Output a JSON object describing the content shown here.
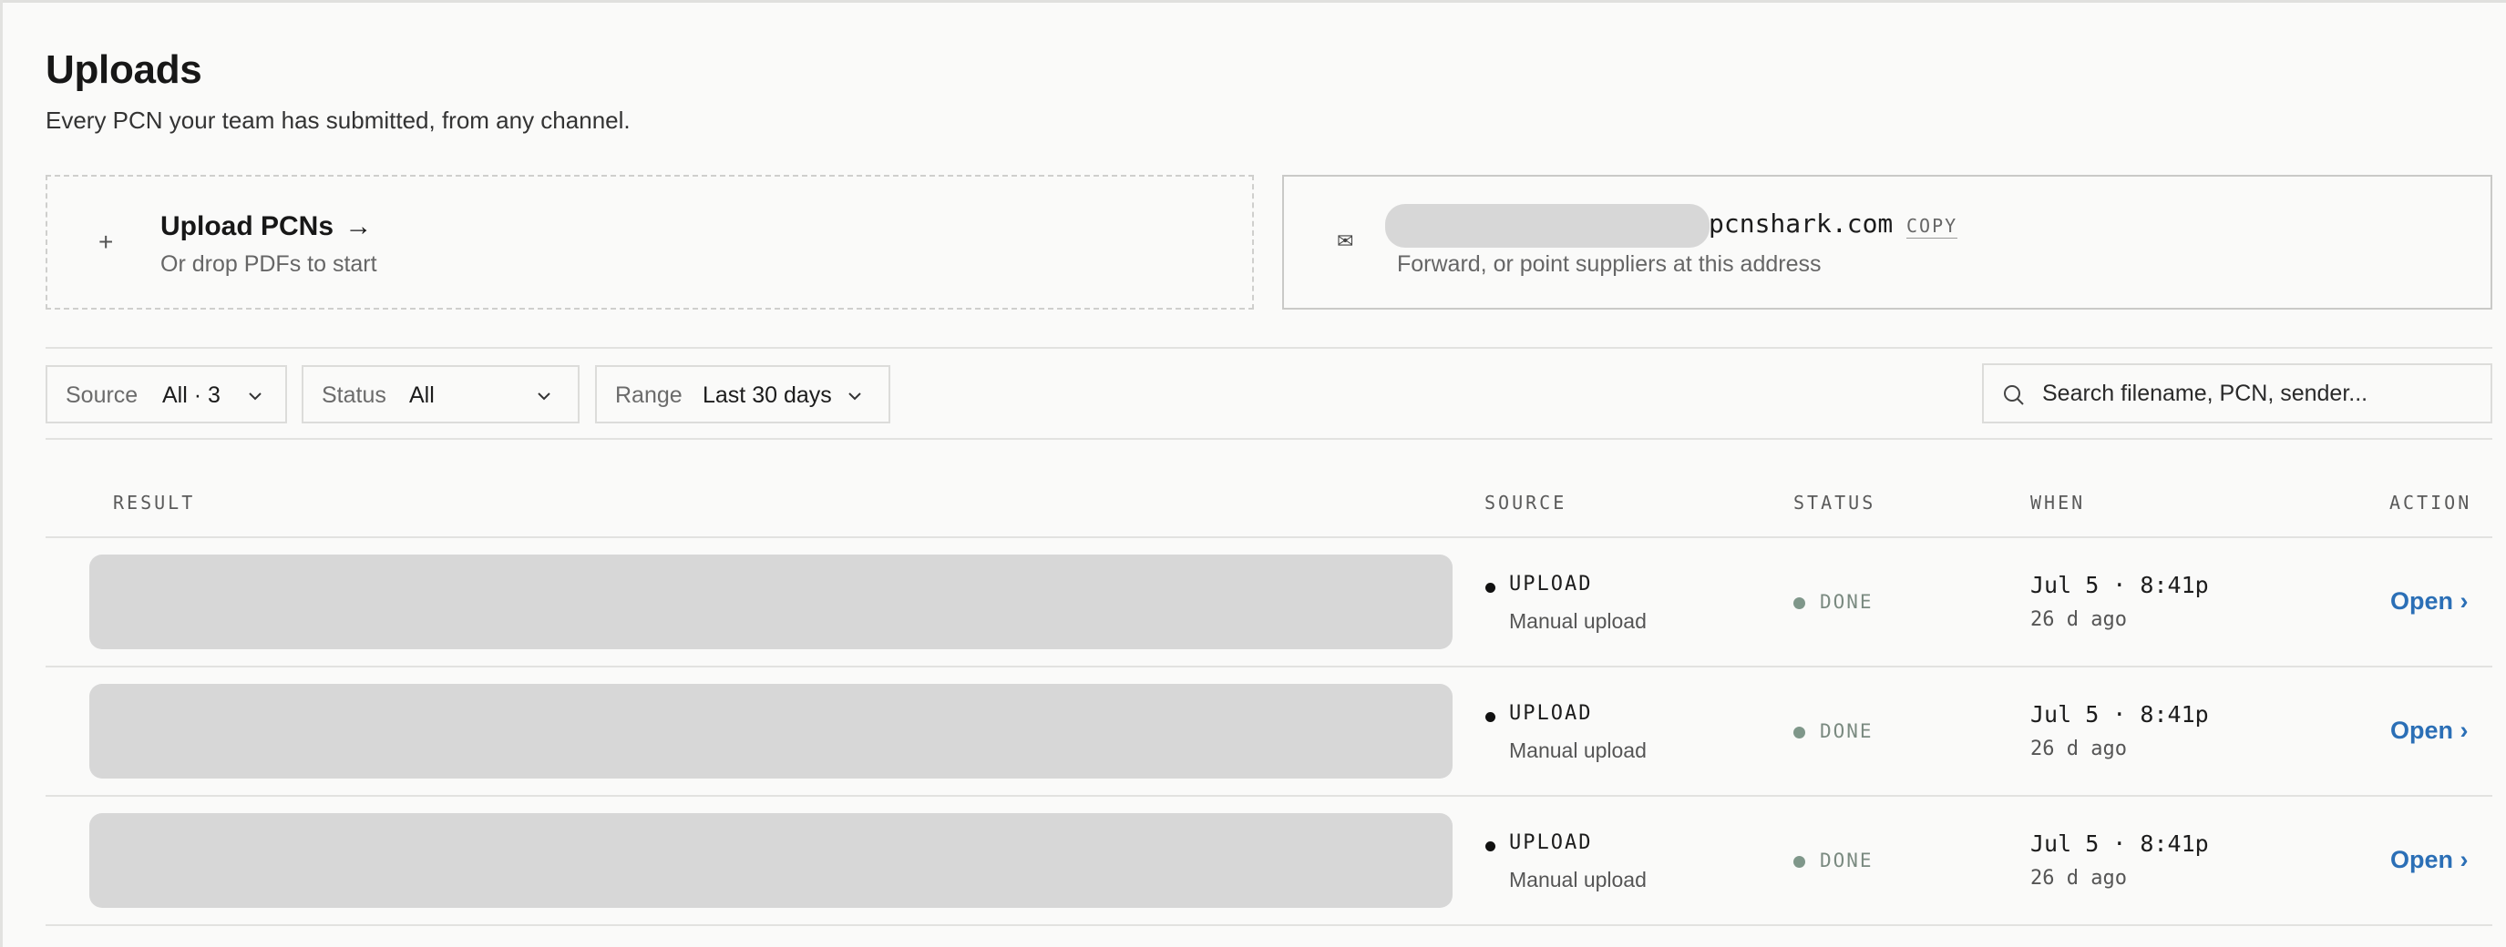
{
  "header": {
    "title": "Uploads",
    "subtitle": "Every PCN your team has submitted, from any channel."
  },
  "upload_card": {
    "plus_icon": "+",
    "title": "Upload PCNs",
    "arrow": "→",
    "subtitle": "Or drop PDFs to start"
  },
  "email_card": {
    "icon": "✉",
    "address_domain": "pcnshark.com",
    "copy_label": "COPY",
    "subtitle": "Forward, or point suppliers at this address"
  },
  "filters": {
    "source": {
      "label": "Source",
      "value": "All · 3"
    },
    "status": {
      "label": "Status",
      "value": "All"
    },
    "range": {
      "label": "Range",
      "value": "Last 30 days"
    }
  },
  "search": {
    "placeholder": "Search filename, PCN, sender..."
  },
  "table": {
    "columns": {
      "result": "RESULT",
      "source": "SOURCE",
      "status": "STATUS",
      "when": "WHEN",
      "action": "ACTION"
    },
    "rows": [
      {
        "source_kind": "UPLOAD",
        "source_detail": "Manual upload",
        "status": "DONE",
        "when_date": "Jul 5 · 8:41p",
        "when_relative": "26 d ago",
        "action": "Open ›"
      },
      {
        "source_kind": "UPLOAD",
        "source_detail": "Manual upload",
        "status": "DONE",
        "when_date": "Jul 5 · 8:41p",
        "when_relative": "26 d ago",
        "action": "Open ›"
      },
      {
        "source_kind": "UPLOAD",
        "source_detail": "Manual upload",
        "status": "DONE",
        "when_date": "Jul 5 · 8:41p",
        "when_relative": "26 d ago",
        "action": "Open ›"
      }
    ]
  },
  "colors": {
    "accent_link": "#2b6fb6",
    "status_done": "#7f978a",
    "redaction": "#d7d7d7"
  }
}
